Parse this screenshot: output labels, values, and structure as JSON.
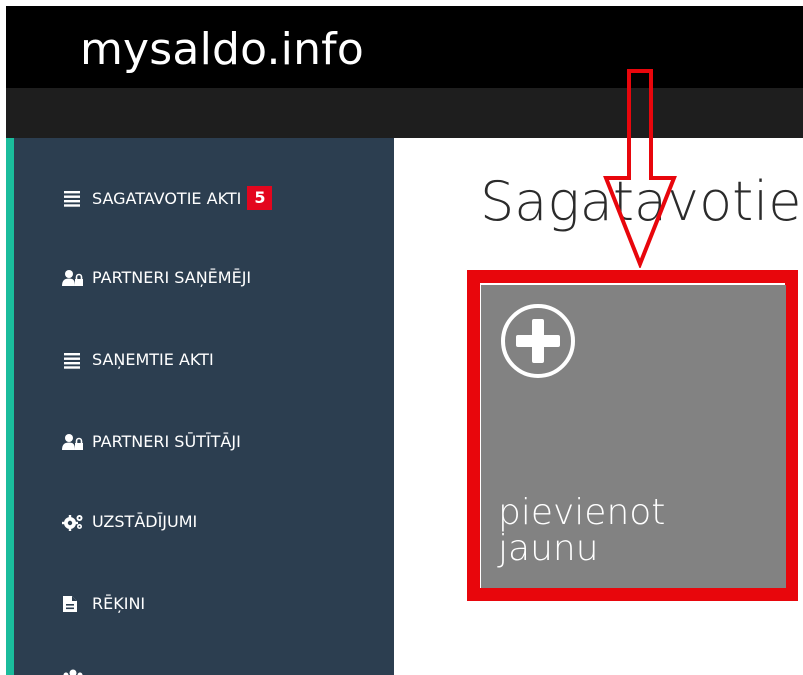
{
  "header": {
    "brand": "mysaldo.info"
  },
  "sidebar": {
    "items": [
      {
        "label": "SAGATAVOTIE AKTI",
        "icon": "list-icon",
        "badge": "5"
      },
      {
        "label": "PARTNERI SAŅĒMĒJI",
        "icon": "users-lock-icon"
      },
      {
        "label": "SAŅEMTIE AKTI",
        "icon": "list-icon"
      },
      {
        "label": "PARTNERI SŪTĪTĀJI",
        "icon": "users-lock-icon"
      },
      {
        "label": "UZSTĀDĪJUMI",
        "icon": "gears-icon"
      },
      {
        "label": "RĒĶINI",
        "icon": "file-icon"
      }
    ]
  },
  "main": {
    "title": "Sagatavotie",
    "add_tile": {
      "label_line1": "pievienot",
      "label_line2": "jaunu",
      "icon": "plus-circle-icon"
    }
  },
  "annotations": {
    "highlight_color": "#e8060c",
    "arrow_color": "#e8060c"
  },
  "colors": {
    "sidebar_bg": "#2c3e50",
    "sidebar_accent": "#1abc9c",
    "badge_bg": "#e3061e",
    "tile_bg": "#828282",
    "topbar_bg": "#000000"
  }
}
